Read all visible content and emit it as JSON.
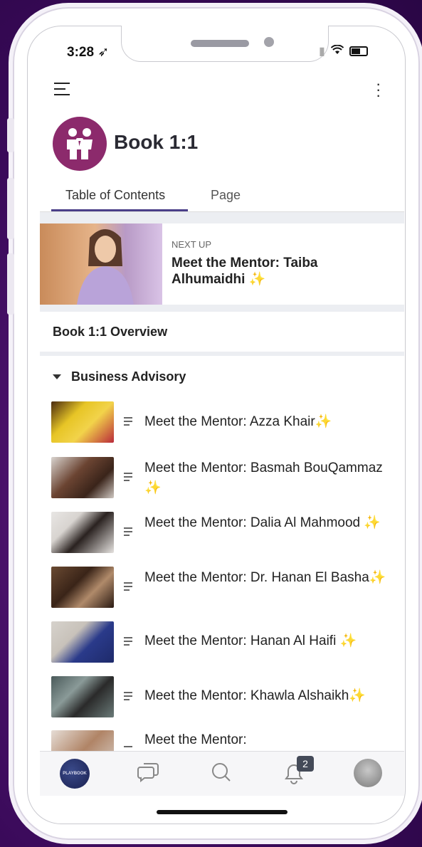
{
  "status": {
    "time": "3:28 ➶"
  },
  "header": {
    "space_title": "Book 1:1"
  },
  "tabs": [
    {
      "label": "Table of Contents"
    },
    {
      "label": "Page"
    }
  ],
  "next_up": {
    "label": "NEXT UP",
    "title": "Meet the Mentor: Taiba Alhumaidhi ✨"
  },
  "overview": {
    "label": "Book 1:1 Overview"
  },
  "section": {
    "title": "Business Advisory"
  },
  "items": [
    {
      "label": "Meet the Mentor: Azza Khair✨"
    },
    {
      "label": "Meet the Mentor: Basmah BouQammaz ✨"
    },
    {
      "label": "Meet the Mentor: Dalia Al Mahmood ✨"
    },
    {
      "label": "Meet the Mentor: Dr. Hanan El Basha✨"
    },
    {
      "label": "Meet the Mentor: Hanan Al Haifi ✨"
    },
    {
      "label": "Meet the Mentor: Khawla Alshaikh✨"
    },
    {
      "label": "Meet the Mentor:"
    }
  ],
  "tabbar": {
    "home_logo_text": "PLAYBOOK",
    "notifications_badge": "2"
  },
  "colors": {
    "accent": "#4a3f88",
    "space_logo": "#8c2a6c",
    "background": "#3a0a5a"
  }
}
